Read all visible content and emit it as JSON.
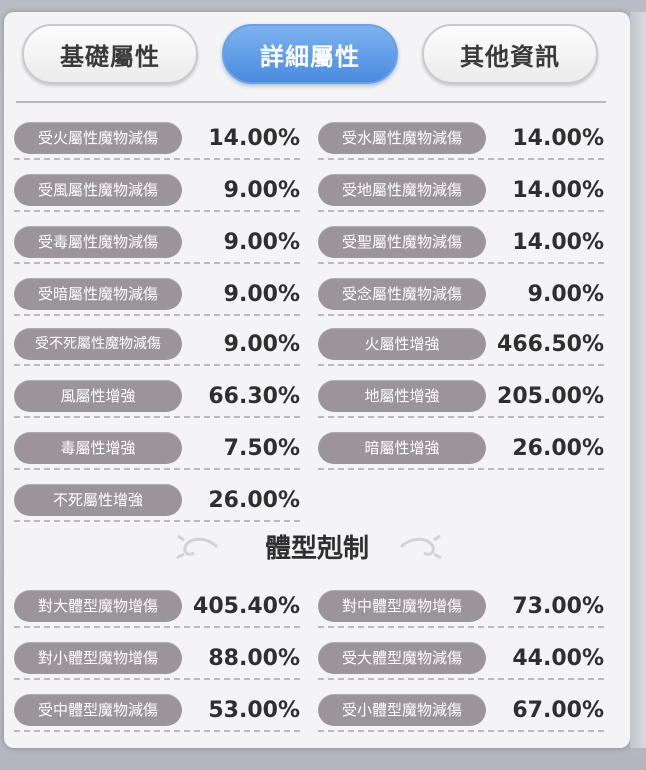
{
  "tabs": [
    {
      "label": "基礎屬性",
      "active": false
    },
    {
      "label": "詳細屬性",
      "active": true
    },
    {
      "label": "其他資訊",
      "active": false
    }
  ],
  "attributes": [
    {
      "label": "受火屬性魔物減傷",
      "value": "14.00%"
    },
    {
      "label": "受水屬性魔物減傷",
      "value": "14.00%"
    },
    {
      "label": "受風屬性魔物減傷",
      "value": "9.00%"
    },
    {
      "label": "受地屬性魔物減傷",
      "value": "14.00%"
    },
    {
      "label": "受毒屬性魔物減傷",
      "value": "9.00%"
    },
    {
      "label": "受聖屬性魔物減傷",
      "value": "14.00%"
    },
    {
      "label": "受暗屬性魔物減傷",
      "value": "9.00%"
    },
    {
      "label": "受念屬性魔物減傷",
      "value": "9.00%"
    },
    {
      "label": "受不死屬性魔物減傷",
      "value": "9.00%"
    },
    {
      "label": "火屬性增強",
      "value": "466.50%"
    },
    {
      "label": "風屬性增強",
      "value": "66.30%"
    },
    {
      "label": "地屬性增強",
      "value": "205.00%"
    },
    {
      "label": "毒屬性增強",
      "value": "7.50%"
    },
    {
      "label": "暗屬性增強",
      "value": "26.00%"
    },
    {
      "label": "不死屬性增強",
      "value": "26.00%"
    }
  ],
  "body_type_section": {
    "title": "體型剋制",
    "items": [
      {
        "label": "對大體型魔物增傷",
        "value": "405.40%"
      },
      {
        "label": "對中體型魔物增傷",
        "value": "73.00%"
      },
      {
        "label": "對小體型魔物增傷",
        "value": "88.00%"
      },
      {
        "label": "受大體型魔物減傷",
        "value": "44.00%"
      },
      {
        "label": "受中體型魔物減傷",
        "value": "53.00%"
      },
      {
        "label": "受小體型魔物減傷",
        "value": "67.00%"
      }
    ]
  },
  "colors": {
    "active_tab": "#4a8ae0",
    "label_pill": "#9b9499",
    "value_text": "#2f2f2f"
  }
}
